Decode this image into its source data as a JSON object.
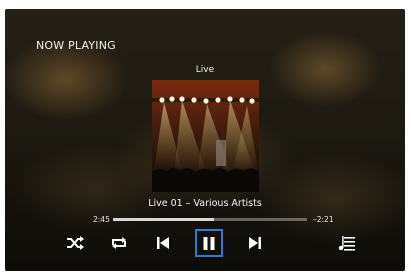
{
  "header": {
    "title": "NOW PLAYING"
  },
  "player": {
    "source": "Live",
    "track": "Live 01 – Various Artists",
    "elapsed": "2:45",
    "remaining": "–2:21",
    "progress": 0.52,
    "selected_control": "pause"
  },
  "controls": [
    {
      "name": "shuffle",
      "icon": "shuffle-icon"
    },
    {
      "name": "repeat",
      "icon": "repeat-icon"
    },
    {
      "name": "previous",
      "icon": "skip-previous-icon"
    },
    {
      "name": "pause",
      "icon": "pause-icon"
    },
    {
      "name": "next",
      "icon": "skip-next-icon"
    },
    {
      "name": "queue",
      "icon": "playlist-icon"
    }
  ],
  "colors": {
    "accent_focus": "#2f7ad6",
    "text": "#f2f2f2"
  }
}
